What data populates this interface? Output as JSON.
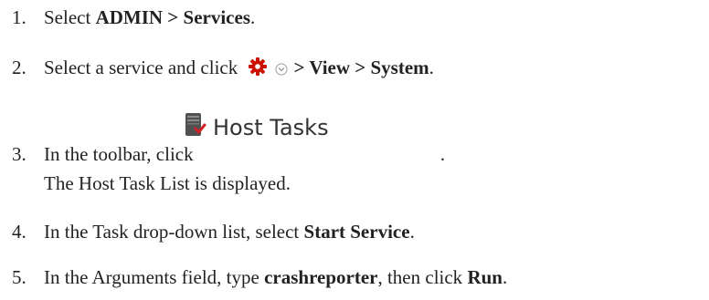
{
  "steps": [
    {
      "num": "1.",
      "text": "Select ",
      "b1": "ADMIN > Services",
      "tail": "."
    },
    {
      "num": "2.",
      "text": "Select a service and click ",
      "b1": "> View > System",
      "tail": ".",
      "icons": [
        "gear-icon",
        "chevron-down-icon"
      ]
    },
    {
      "num": "3.",
      "text": "In the toolbar, click ",
      "button_label": "Host Tasks",
      "tail": ".",
      "line2": "The Host Task List is displayed.",
      "icons": [
        "host-tasks-icon"
      ]
    },
    {
      "num": "4.",
      "text": "In the Task drop-down list, select ",
      "b1": "Start Service",
      "tail": "."
    },
    {
      "num": "5.",
      "text": "In the Arguments field, type ",
      "b1": "crashreporter",
      "mid": ", then click ",
      "b2": "Run",
      "tail": "."
    }
  ],
  "colors": {
    "gear": "#cc1100",
    "text": "#222222"
  }
}
